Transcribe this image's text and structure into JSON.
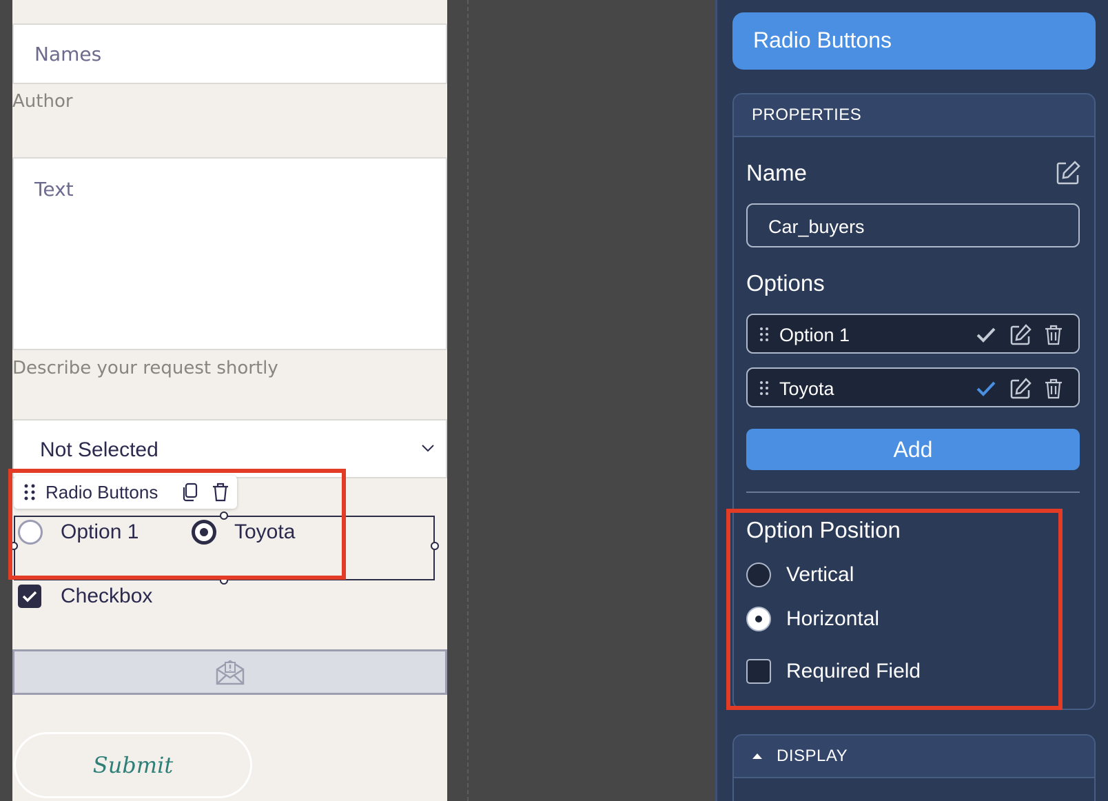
{
  "form": {
    "names_placeholder": "Names",
    "author_helper": "Author",
    "text_placeholder": "Text",
    "text_helper": "Describe your request shortly",
    "select_value": "Not Selected",
    "element_toolbar_label": "Radio Buttons",
    "radio_options": [
      "Option 1",
      "Toyota"
    ],
    "radio_selected_index": 1,
    "checkbox_label": "Checkbox",
    "checkbox_checked": true,
    "submit_label": "Submit"
  },
  "panel": {
    "title": "Radio Buttons",
    "properties_header": "PROPERTIES",
    "name_label": "Name",
    "name_value": "Car_buyers",
    "options_label": "Options",
    "options": [
      {
        "label": "Option 1",
        "check_color": "#c5cbd6"
      },
      {
        "label": "Toyota",
        "check_color": "#4a8fe2"
      }
    ],
    "add_label": "Add",
    "option_position_label": "Option Position",
    "position_options": [
      "Vertical",
      "Horizontal"
    ],
    "position_selected": "Horizontal",
    "required_label": "Required Field",
    "required_checked": false,
    "display_header": "DISPLAY"
  },
  "colors": {
    "accent": "#4a8fe2",
    "highlight": "#e23c26",
    "panel_bg": "#2b3a57"
  }
}
